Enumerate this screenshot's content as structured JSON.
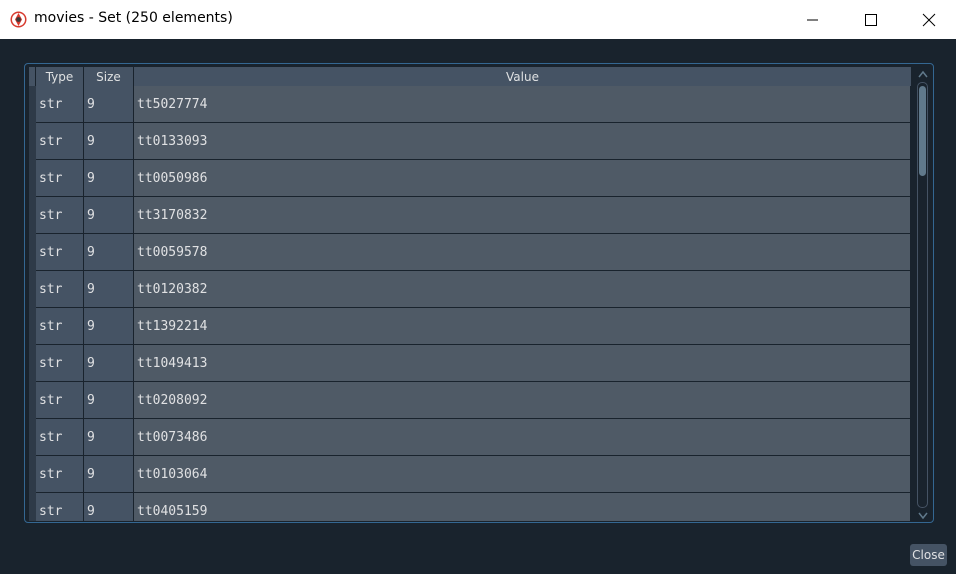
{
  "window": {
    "title": "movies - Set (250 elements)",
    "icons": {
      "app": "spyder-icon",
      "minimize": "minimize-icon",
      "maximize": "maximize-icon",
      "close": "close-icon"
    }
  },
  "table": {
    "headers": {
      "type": "Type",
      "size": "Size",
      "value": "Value"
    },
    "rows": [
      {
        "type": "str",
        "size": "9",
        "value": "tt5027774"
      },
      {
        "type": "str",
        "size": "9",
        "value": "tt0133093"
      },
      {
        "type": "str",
        "size": "9",
        "value": "tt0050986"
      },
      {
        "type": "str",
        "size": "9",
        "value": "tt3170832"
      },
      {
        "type": "str",
        "size": "9",
        "value": "tt0059578"
      },
      {
        "type": "str",
        "size": "9",
        "value": "tt0120382"
      },
      {
        "type": "str",
        "size": "9",
        "value": "tt1392214"
      },
      {
        "type": "str",
        "size": "9",
        "value": "tt1049413"
      },
      {
        "type": "str",
        "size": "9",
        "value": "tt0208092"
      },
      {
        "type": "str",
        "size": "9",
        "value": "tt0073486"
      },
      {
        "type": "str",
        "size": "9",
        "value": "tt0103064"
      },
      {
        "type": "str",
        "size": "9",
        "value": "tt0405159"
      }
    ]
  },
  "footer": {
    "close_label": "Close"
  },
  "colors": {
    "background": "#19232d",
    "cell": "#455364",
    "value_cell": "#4f5a66",
    "accent": "#346792"
  }
}
